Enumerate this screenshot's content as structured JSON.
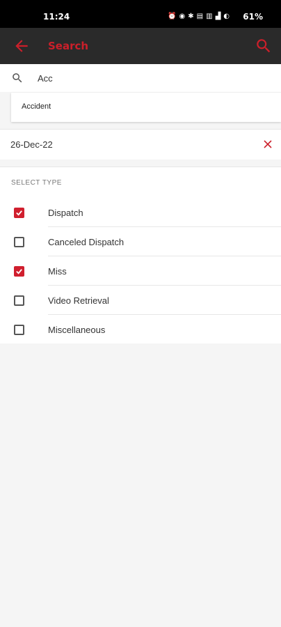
{
  "status_bar": {
    "time": "11:24",
    "icons": [
      "alarm-icon",
      "sync-icon",
      "bluetooth-icon",
      "volte-icon",
      "wifi-icon",
      "signal-icon",
      "signal-icon"
    ],
    "battery_text": "61%"
  },
  "app_bar": {
    "title": "Search",
    "accent_color": "#cc1f2a",
    "back_icon": "arrow-left-icon",
    "search_icon": "search-icon"
  },
  "search": {
    "value": "Acc",
    "placeholder": ""
  },
  "suggestions": [
    "Accident"
  ],
  "date_filter": {
    "value": "26-Dec-22",
    "clear_icon": "close-icon"
  },
  "type_section": {
    "label": "SELECT TYPE",
    "items": [
      {
        "label": "Dispatch",
        "checked": true
      },
      {
        "label": "Canceled Dispatch",
        "checked": false
      },
      {
        "label": "Miss",
        "checked": true
      },
      {
        "label": "Video Retrieval",
        "checked": false
      },
      {
        "label": "Miscellaneous",
        "checked": false
      }
    ]
  }
}
